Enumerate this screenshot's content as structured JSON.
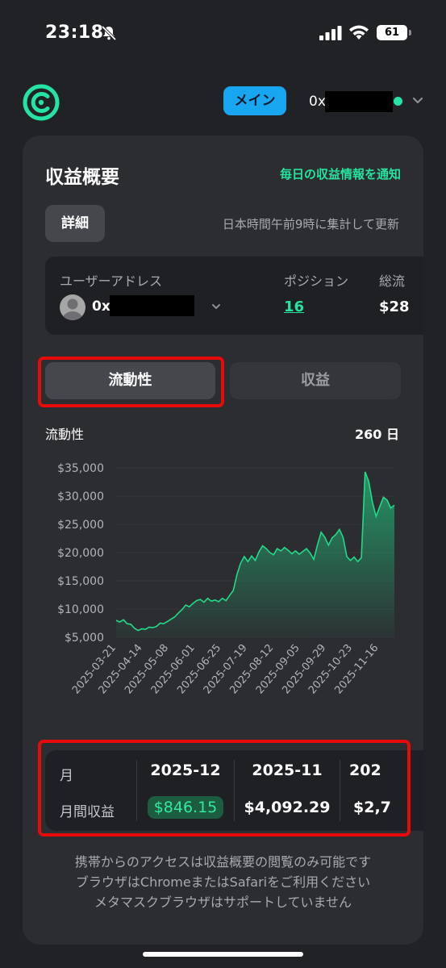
{
  "status": {
    "time": "23:18",
    "battery": "61"
  },
  "header": {
    "main_label": "メイン",
    "address_prefix": "0x"
  },
  "card": {
    "title": "収益概要",
    "notify_link": "毎日の収益情報を通知",
    "detail_button": "詳細",
    "update_note": "日本時間午前9時に集計して更新"
  },
  "info": {
    "user_address_label": "ユーザーアドレス",
    "user_address_prefix": "0x",
    "positions_label": "ポジション",
    "positions_value": "16",
    "total_label": "総流",
    "total_value": "$28"
  },
  "tabs": {
    "liquidity": "流動性",
    "revenue": "収益"
  },
  "chart_header": {
    "title": "流動性",
    "days": "260 日"
  },
  "chart_data": {
    "type": "area",
    "color": "#25d98a",
    "ylim": [
      5000,
      35000
    ],
    "yticks": [
      "$35,000",
      "$30,000",
      "$25,000",
      "$20,000",
      "$15,000",
      "$10,000",
      "$5,000"
    ],
    "xticks": [
      "2025-03-21",
      "2025-04-14",
      "2025-05-08",
      "2025-06-01",
      "2025-06-25",
      "2025-07-19",
      "2025-08-12",
      "2025-09-05",
      "2025-09-29",
      "2025-10-23",
      "2025-11-16"
    ],
    "x_start": "2025-03-21",
    "series": [
      {
        "values": [
          8000,
          7700,
          8100,
          7400,
          7300,
          6600,
          6200,
          6500,
          6400,
          6800,
          6700,
          6900,
          7500,
          7400,
          7800,
          8200,
          8600,
          9300,
          9900,
          10700,
          10400,
          11000,
          11500,
          11700,
          11200,
          11900,
          11400,
          11600,
          11300,
          11900,
          11500,
          12400,
          13300,
          16100,
          18100,
          19300,
          18400,
          19400,
          18600,
          20100,
          21200,
          20700,
          20000,
          19600,
          20700,
          20300,
          20900,
          20400,
          19800,
          20300,
          19700,
          20200,
          20700,
          19900,
          18800,
          21400,
          23600,
          22700,
          21300,
          22600,
          23200,
          24100,
          22700,
          19300,
          18600,
          19200,
          18400,
          19100,
          34300,
          32600,
          28900,
          26400,
          28100,
          29800,
          29300,
          27900,
          28400
        ]
      }
    ]
  },
  "monthly": {
    "row1_label": "月",
    "row2_label": "月間収益",
    "months": [
      "2025-12",
      "2025-11",
      "202"
    ],
    "values": [
      "$846.15",
      "$4,092.29",
      "$2,7"
    ]
  },
  "footer": {
    "line1": "携帯からのアクセスは収益概要の閲覧のみ可能です",
    "line2": "ブラウザはChromeまたはSafariをご利用ください",
    "line3": "メタマスクブラウザはサポートしていません"
  },
  "colors": {
    "accent": "#26e39e",
    "main_button": "#19a6f0",
    "highlight": "#e60a0a"
  }
}
